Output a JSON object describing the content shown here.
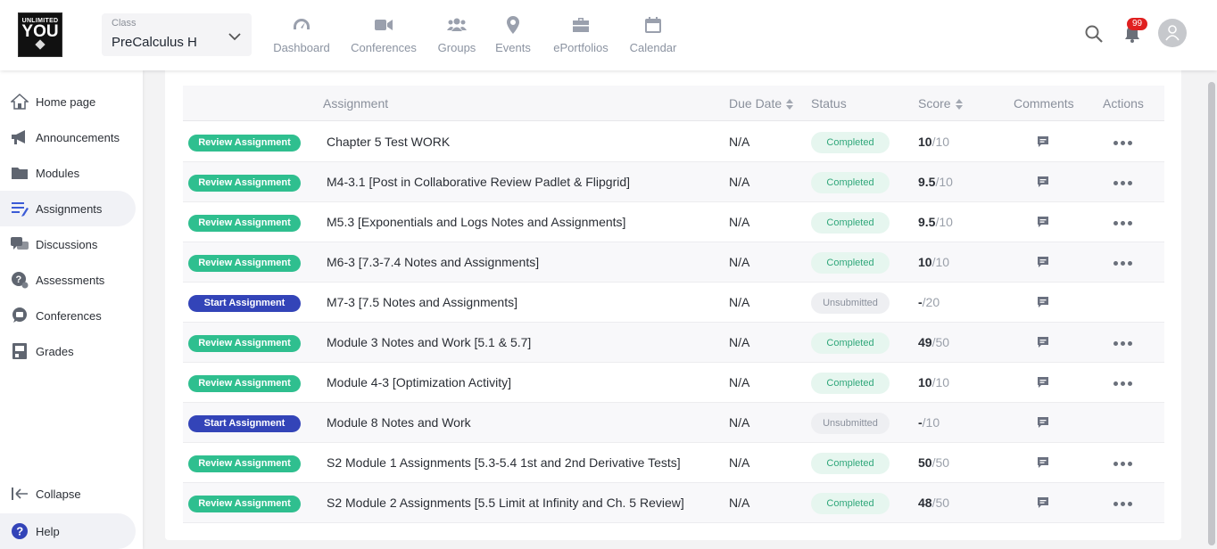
{
  "logo": {
    "line1": "UNLIMITED",
    "line2": "YOU"
  },
  "class_selector": {
    "caption": "Class",
    "value": "PreCalculus H"
  },
  "nav": [
    {
      "label": "Dashboard",
      "icon": "gauge-icon"
    },
    {
      "label": "Conferences",
      "icon": "video-camera-icon"
    },
    {
      "label": "Groups",
      "icon": "people-icon"
    },
    {
      "label": "Events",
      "icon": "map-pin-icon"
    },
    {
      "label": "ePortfolios",
      "icon": "briefcase-icon"
    },
    {
      "label": "Calendar",
      "icon": "calendar-icon"
    }
  ],
  "notifications": {
    "count": "99"
  },
  "sidebar": {
    "items": [
      {
        "label": "Home page",
        "icon": "home-icon"
      },
      {
        "label": "Announcements",
        "icon": "megaphone-icon"
      },
      {
        "label": "Modules",
        "icon": "folder-icon"
      },
      {
        "label": "Assignments",
        "icon": "assignment-icon"
      },
      {
        "label": "Discussions",
        "icon": "discussion-icon"
      },
      {
        "label": "Assessments",
        "icon": "assessment-icon"
      },
      {
        "label": "Conferences",
        "icon": "chat-bubble-icon"
      },
      {
        "label": "Grades",
        "icon": "gradebook-icon"
      }
    ],
    "collapse": "Collapse",
    "help": "Help"
  },
  "table": {
    "headers": {
      "assignment": "Assignment",
      "due_date": "Due Date",
      "status": "Status",
      "score": "Score",
      "comments": "Comments",
      "actions": "Actions"
    },
    "rows": [
      {
        "button": "Review Assignment",
        "type": "review",
        "name": "Chapter 5 Test WORK",
        "due": "N/A",
        "status": "Completed",
        "score": "10",
        "total": "/10",
        "actions": true
      },
      {
        "button": "Review Assignment",
        "type": "review",
        "name": "M4-3.1 [Post in Collaborative Review Padlet & Flipgrid]",
        "due": "N/A",
        "status": "Completed",
        "score": "9.5",
        "total": "/10",
        "actions": true
      },
      {
        "button": "Review Assignment",
        "type": "review",
        "name": "M5.3 [Exponentials and Logs Notes and Assignments]",
        "due": "N/A",
        "status": "Completed",
        "score": "9.5",
        "total": "/10",
        "actions": true
      },
      {
        "button": "Review Assignment",
        "type": "review",
        "name": "M6-3 [7.3-7.4 Notes and Assignments]",
        "due": "N/A",
        "status": "Completed",
        "score": "10",
        "total": "/10",
        "actions": true
      },
      {
        "button": "Start Assignment",
        "type": "start",
        "name": "M7-3 [7.5 Notes and Assignments]",
        "due": "N/A",
        "status": "Unsubmitted",
        "score": "-",
        "total": "/20",
        "actions": false
      },
      {
        "button": "Review Assignment",
        "type": "review",
        "name": "Module 3 Notes and Work [5.1 & 5.7]",
        "due": "N/A",
        "status": "Completed",
        "score": "49",
        "total": "/50",
        "actions": true
      },
      {
        "button": "Review Assignment",
        "type": "review",
        "name": "Module 4-3 [Optimization Activity]",
        "due": "N/A",
        "status": "Completed",
        "score": "10",
        "total": "/10",
        "actions": true
      },
      {
        "button": "Start Assignment",
        "type": "start",
        "name": "Module 8 Notes and Work",
        "due": "N/A",
        "status": "Unsubmitted",
        "score": "-",
        "total": "/10",
        "actions": false
      },
      {
        "button": "Review Assignment",
        "type": "review",
        "name": "S2 Module 1 Assignments [5.3-5.4 1st and 2nd Derivative Tests]",
        "due": "N/A",
        "status": "Completed",
        "score": "50",
        "total": "/50",
        "actions": true
      },
      {
        "button": "Review Assignment",
        "type": "review",
        "name": "S2 Module 2 Assignments [5.5 Limit at Infinity and Ch. 5 Review]",
        "due": "N/A",
        "status": "Completed",
        "score": "48",
        "total": "/50",
        "actions": true
      }
    ]
  },
  "colors": {
    "review_button": "#2fbf8f",
    "start_button": "#3344b8",
    "completed_text": "#2fa77a",
    "badge": "#e02020"
  }
}
